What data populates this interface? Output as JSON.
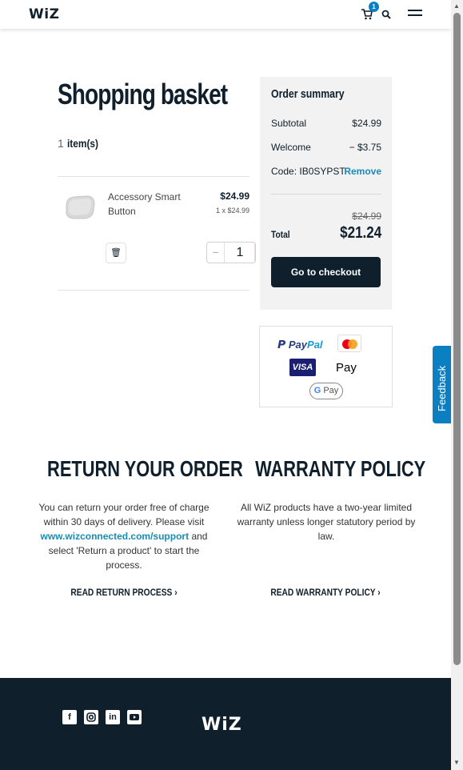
{
  "header": {
    "logo": "WiZ",
    "cart_count": "1"
  },
  "basket": {
    "title": "Shopping basket",
    "item_count_num": "1",
    "item_count_label": "item(s)",
    "item": {
      "name": "Accessory Smart Button",
      "price": "$24.99",
      "unit": "1 x $24.99",
      "quantity": "1"
    }
  },
  "summary": {
    "title": "Order summary",
    "subtotal_label": "Subtotal",
    "subtotal_value": "$24.99",
    "discount_label": "Welcome",
    "discount_value": "− $3.75",
    "code_label": "Code: IB0SYPST",
    "remove_label": "Remove",
    "original_total": "$24.99",
    "total_label": "Total",
    "total_value": "$21.24",
    "checkout_label": "Go to checkout"
  },
  "payments": {
    "paypal_a": "Pay",
    "paypal_b": "Pal",
    "visa": "VISA",
    "applepay": "Pay",
    "gpay": "Pay"
  },
  "feedback": {
    "label": "Feedback"
  },
  "return": {
    "title": "RETURN YOUR ORDER",
    "text_1": "You can return your order free of charge within 30 days of delivery. Please visit",
    "link": "www.wizconnected.com/support",
    "text_2": "and select 'Return a product' to start the process.",
    "cta": "READ RETURN PROCESS"
  },
  "warranty": {
    "title": "WARRANTY POLICY",
    "text": "All WiZ products have a two-year limited warranty unless longer statutory period by law.",
    "cta": "READ WARRANTY POLICY"
  },
  "footer": {
    "logo": "WiZ",
    "social_icons": [
      "facebook-icon",
      "instagram-icon",
      "linkedin-icon",
      "youtube-icon"
    ]
  },
  "colors": {
    "navy": "#0f1f2c",
    "accent_blue": "#0a7fc2",
    "link_teal": "#1a8bb5",
    "summary_bg": "#f2f2f2"
  }
}
